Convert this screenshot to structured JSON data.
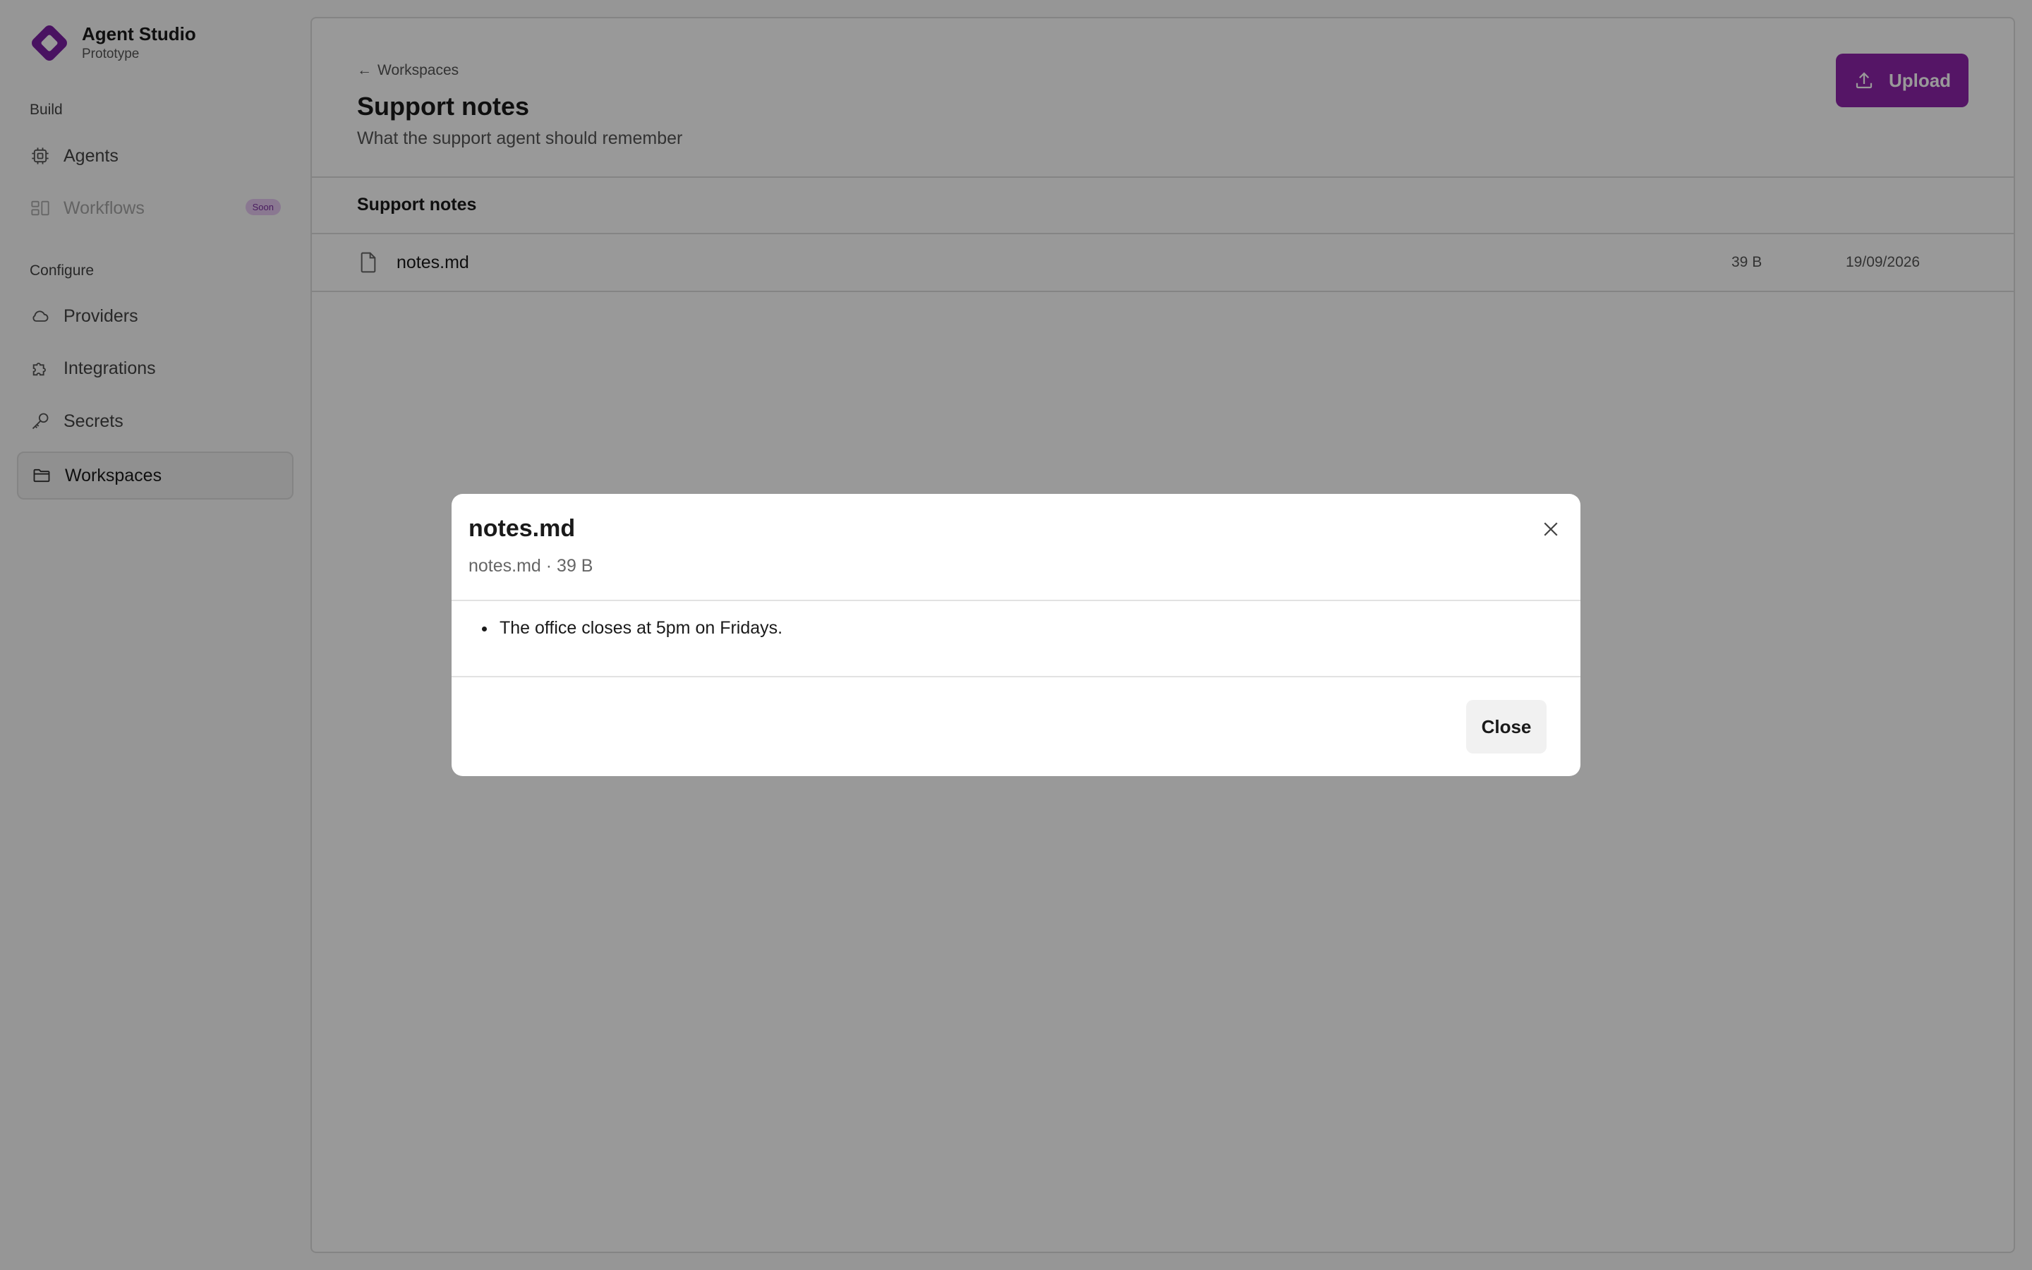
{
  "app": {
    "name": "Agent Studio",
    "subtitle": "Prototype",
    "accent_color": "#8e24aa"
  },
  "sidebar": {
    "sections": [
      {
        "label": "Build",
        "items": [
          {
            "label": "Agents",
            "icon": "chip-icon",
            "state": "normal"
          },
          {
            "label": "Workflows",
            "icon": "workflow-icon",
            "state": "disabled",
            "badge": "Soon"
          }
        ]
      },
      {
        "label": "Configure",
        "items": [
          {
            "label": "Providers",
            "icon": "cloud-icon",
            "state": "normal"
          },
          {
            "label": "Integrations",
            "icon": "puzzle-icon",
            "state": "normal"
          },
          {
            "label": "Secrets",
            "icon": "key-icon",
            "state": "normal"
          },
          {
            "label": "Workspaces",
            "icon": "folder-icon",
            "state": "active"
          }
        ]
      }
    ]
  },
  "header": {
    "back_label": "Workspaces",
    "title": "Support notes",
    "subtitle": "What the support agent should remember",
    "upload_label": "Upload"
  },
  "files": {
    "section_title": "Support notes",
    "rows": [
      {
        "name": "notes.md",
        "size": "39 B",
        "date": "19/09/2026",
        "icon": "file-icon"
      }
    ]
  },
  "modal": {
    "title": "notes.md",
    "meta": "notes.md · 39 B",
    "content_items": [
      "The office closes at 5pm on Fridays."
    ],
    "close_label": "Close"
  }
}
